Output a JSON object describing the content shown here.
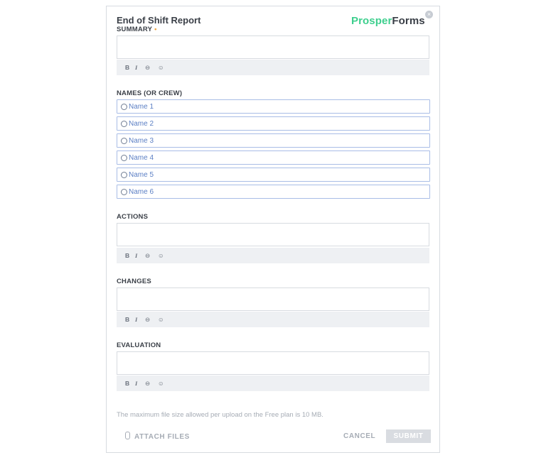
{
  "form": {
    "title": "End of Shift Report",
    "close_glyph": "×"
  },
  "logo": {
    "part1": "Prosper",
    "part2": "Forms"
  },
  "summary": {
    "label": "SUMMARY",
    "required_mark": "•"
  },
  "names": {
    "label": "NAMES (OR CREW)",
    "options": [
      "Name 1",
      "Name 2",
      "Name 3",
      "Name 4",
      "Name 5",
      "Name 6"
    ]
  },
  "actions": {
    "label": "ACTIONS"
  },
  "changes": {
    "label": "CHANGES"
  },
  "evaluation": {
    "label": "EVALUATION"
  },
  "toolbar": {
    "bold": "B",
    "italic": "I",
    "link": "⊖",
    "emoji": "☺"
  },
  "footer": {
    "note": "The maximum file size allowed per upload on the Free plan is 10 MB.",
    "attach_label": "ATTACH FILES",
    "cancel_label": "CANCEL",
    "submit_label": "SUBMIT"
  },
  "colors": {
    "brand_green": "#3ecf8e",
    "option_blue": "#5b7fc4",
    "required_orange": "#f0a33a"
  }
}
